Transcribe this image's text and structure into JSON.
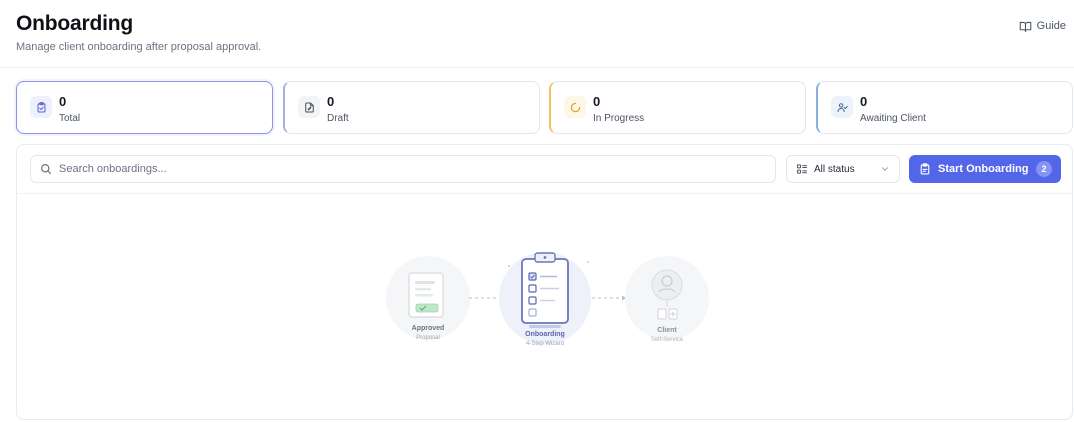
{
  "header": {
    "title": "Onboarding",
    "subtitle": "Manage client onboarding after proposal approval.",
    "guide_label": "Guide"
  },
  "stats": [
    {
      "value": "0",
      "label": "Total",
      "icon": "clipboard-check-icon",
      "accent": "#6366f1"
    },
    {
      "value": "0",
      "label": "Draft",
      "icon": "file-edit-icon",
      "accent": "#a9aedc"
    },
    {
      "value": "0",
      "label": "In Progress",
      "icon": "loader-icon",
      "accent": "#f0c45c"
    },
    {
      "value": "0",
      "label": "Awaiting Client",
      "icon": "user-check-icon",
      "accent": "#8bb0e0"
    }
  ],
  "toolbar": {
    "search_placeholder": "Search onboardings...",
    "search_value": "",
    "status_filter": "All status",
    "start_button_label": "Start Onboarding",
    "start_button_badge": "2",
    "accent_color": "#5366ea"
  },
  "empty_state": {
    "steps": [
      {
        "title": "Approved",
        "subtitle": "Proposal"
      },
      {
        "title": "Onboarding",
        "subtitle": "4-Step Wizard"
      },
      {
        "title": "Client",
        "subtitle": "Self-Service"
      }
    ]
  }
}
